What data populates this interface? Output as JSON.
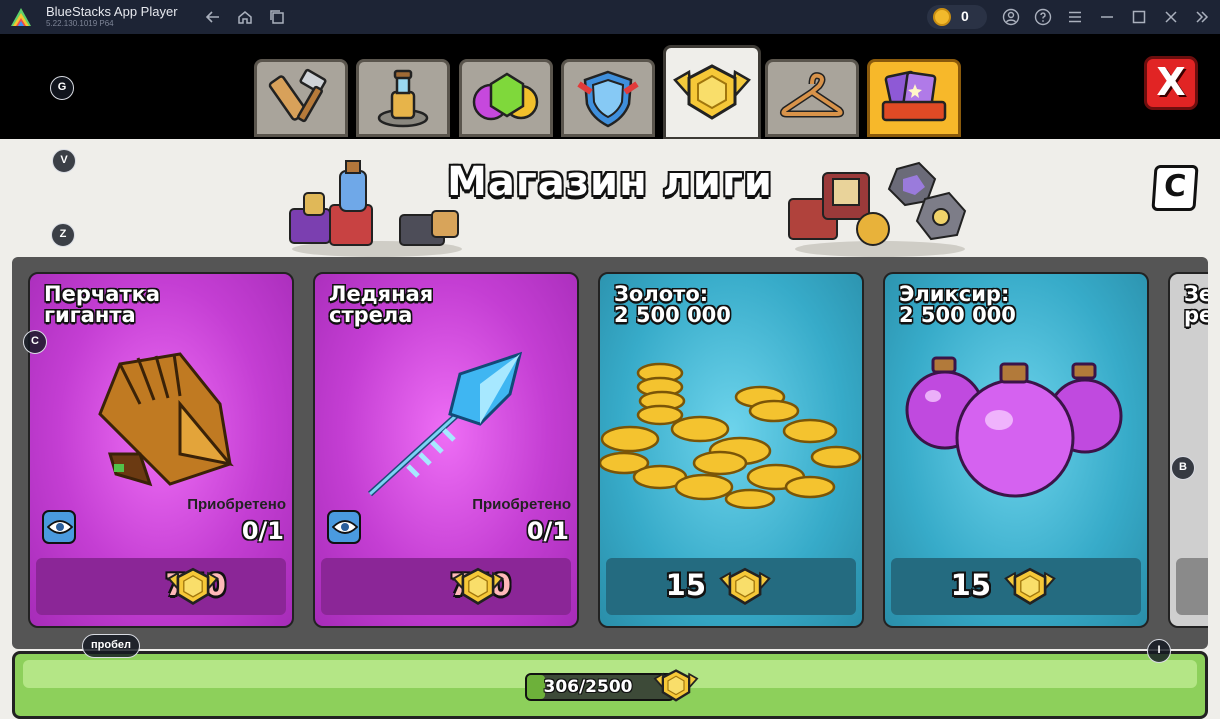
{
  "window": {
    "app_name": "BlueStacks App Player",
    "app_version": "5.22.130.1019  P64",
    "coin_balance": "0"
  },
  "toolbar_icons": [
    "back-icon",
    "home-icon",
    "multi-instance-icon",
    "account-icon",
    "help-icon",
    "menu-icon",
    "minimize-icon",
    "maximize-icon",
    "close-window-icon",
    "collapse-sidebar-icon"
  ],
  "tabs": [
    {
      "name": "builder-tools",
      "icon": "tools-icon",
      "active": false
    },
    {
      "name": "magic-items",
      "icon": "potion-icon",
      "active": false
    },
    {
      "name": "resources",
      "icon": "gems-icon",
      "active": false
    },
    {
      "name": "shields",
      "icon": "shield-icon",
      "active": false
    },
    {
      "name": "league-shop",
      "icon": "league-medal-icon",
      "active": true
    },
    {
      "name": "skins",
      "icon": "hanger-icon",
      "active": false
    },
    {
      "name": "cards",
      "icon": "cards-icon",
      "active": false
    }
  ],
  "shop": {
    "title": "Магазин лиги",
    "close_label": "X",
    "currency_icon": "league-medal-icon"
  },
  "cards": [
    {
      "title_line1": "Перчатка",
      "title_line2": "гиганта",
      "status": "Приобретено",
      "count": "0/1",
      "price": "750",
      "theme": "purple",
      "image": "giant-gauntlet-icon"
    },
    {
      "title_line1": "Ледяная",
      "title_line2": "стрела",
      "status": "Приобретено",
      "count": "0/1",
      "price": "750",
      "theme": "purple",
      "image": "frozen-arrow-icon"
    },
    {
      "title_line1": "Золото:",
      "title_line2": "2 500 000",
      "price": "15",
      "theme": "blue",
      "image": "gold-coins-icon"
    },
    {
      "title_line1": "Эликсир:",
      "title_line2": "2 500 000",
      "price": "15",
      "theme": "blue",
      "image": "elixir-bottles-icon"
    },
    {
      "title_line1": "Зе",
      "title_line2": "ре",
      "theme": "grey"
    }
  ],
  "progress": {
    "text": "306/2500",
    "fraction": 0.1224
  },
  "key_hints": {
    "g": "G",
    "v": "V",
    "z": "Z",
    "c": "C",
    "b": "B",
    "space": "пробел",
    "i": "I"
  }
}
